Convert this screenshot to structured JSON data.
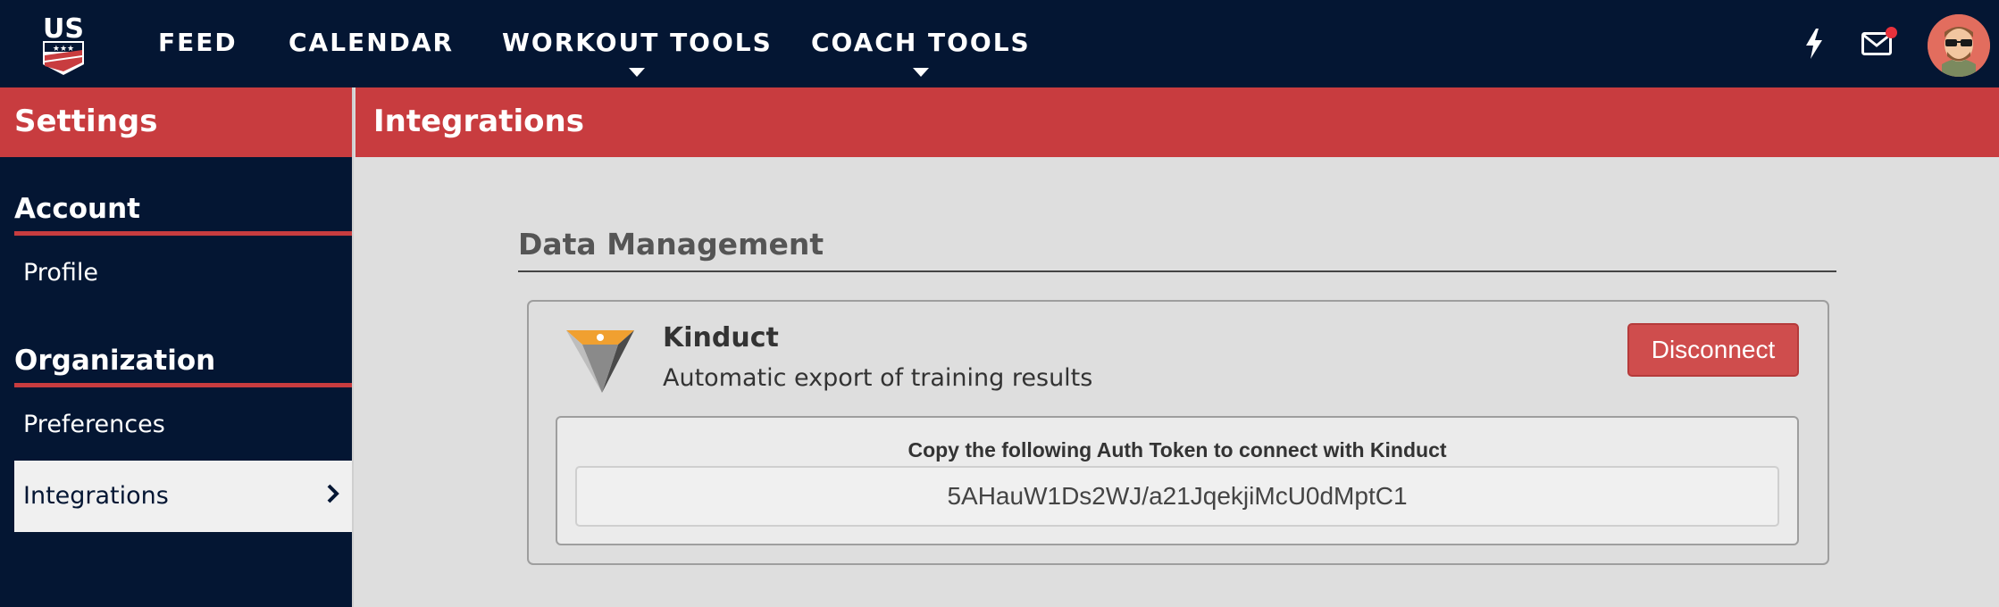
{
  "topnav": {
    "logo_text": "US",
    "items": [
      {
        "label": "FEED",
        "has_dropdown": false
      },
      {
        "label": "CALENDAR",
        "has_dropdown": false
      },
      {
        "label": "WORKOUT TOOLS",
        "has_dropdown": true
      },
      {
        "label": "COACH TOOLS",
        "has_dropdown": true
      }
    ],
    "icons": [
      "lightning-icon",
      "mail-icon"
    ],
    "mail_has_notification": true,
    "colors": {
      "background": "#041633",
      "accent": "#c83c3f",
      "notification": "#e8313c"
    }
  },
  "sidebar": {
    "header": "Settings",
    "sections": [
      {
        "title": "Account",
        "items": [
          {
            "label": "Profile",
            "active": false
          }
        ]
      },
      {
        "title": "Organization",
        "items": [
          {
            "label": "Preferences",
            "active": false
          },
          {
            "label": "Integrations",
            "active": true
          }
        ]
      }
    ]
  },
  "main": {
    "header": "Integrations",
    "section_title": "Data Management",
    "integration": {
      "name": "Kinduct",
      "description": "Automatic export of training results",
      "action_label": "Disconnect",
      "token_label": "Copy the following Auth Token to connect with Kinduct",
      "token_value": "5AHauW1Ds2WJ/a21JqekjiMcU0dMptC1"
    }
  }
}
